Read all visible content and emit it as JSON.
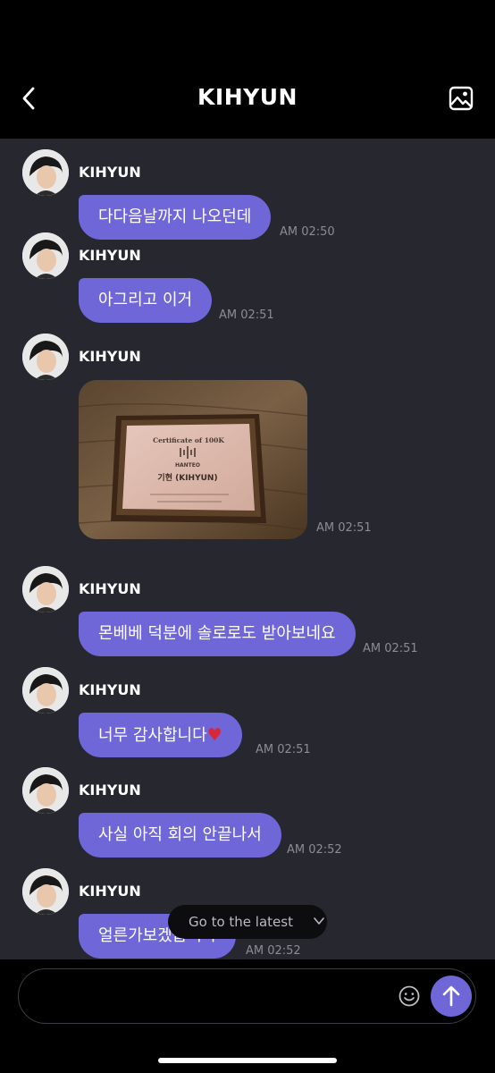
{
  "header": {
    "title": "KIHYUN",
    "back_icon": "chevron-left-icon",
    "gallery_icon": "image-icon"
  },
  "messages": [
    {
      "sender": "KIHYUN",
      "text": "다다음날까지 나오던데",
      "time": "AM 02:50"
    },
    {
      "sender": "KIHYUN",
      "text": "아그리고 이거",
      "time": "AM 02:51"
    },
    {
      "sender": "KIHYUN",
      "type": "image",
      "image_text": {
        "line1": "Certificate of 100K",
        "line2": "HANTEO",
        "line3": "기현 (KIHYUN)"
      },
      "time": "AM 02:51"
    },
    {
      "sender": "KIHYUN",
      "text": "몬베베 덕분에 솔로로도 받아보네요",
      "time": "AM 02:51"
    },
    {
      "sender": "KIHYUN",
      "text": "너무 감사합니다",
      "emoji": "♥",
      "time": "AM 02:51"
    },
    {
      "sender": "KIHYUN",
      "text": "사실 아직 회의 안끝나서",
      "time": "AM 02:52"
    },
    {
      "sender": "KIHYUN",
      "text": "얼른가보겠습니다",
      "time": "AM 02:52"
    }
  ],
  "jump": {
    "label": "Go to the latest"
  },
  "composer": {
    "placeholder": "",
    "emoji_icon": "smiley-icon",
    "send_icon": "arrow-up-icon"
  },
  "colors": {
    "bubble": "#6f66d8",
    "chat_bg": "#26272f",
    "header_bg": "#000000",
    "time": "#8b8c94"
  }
}
